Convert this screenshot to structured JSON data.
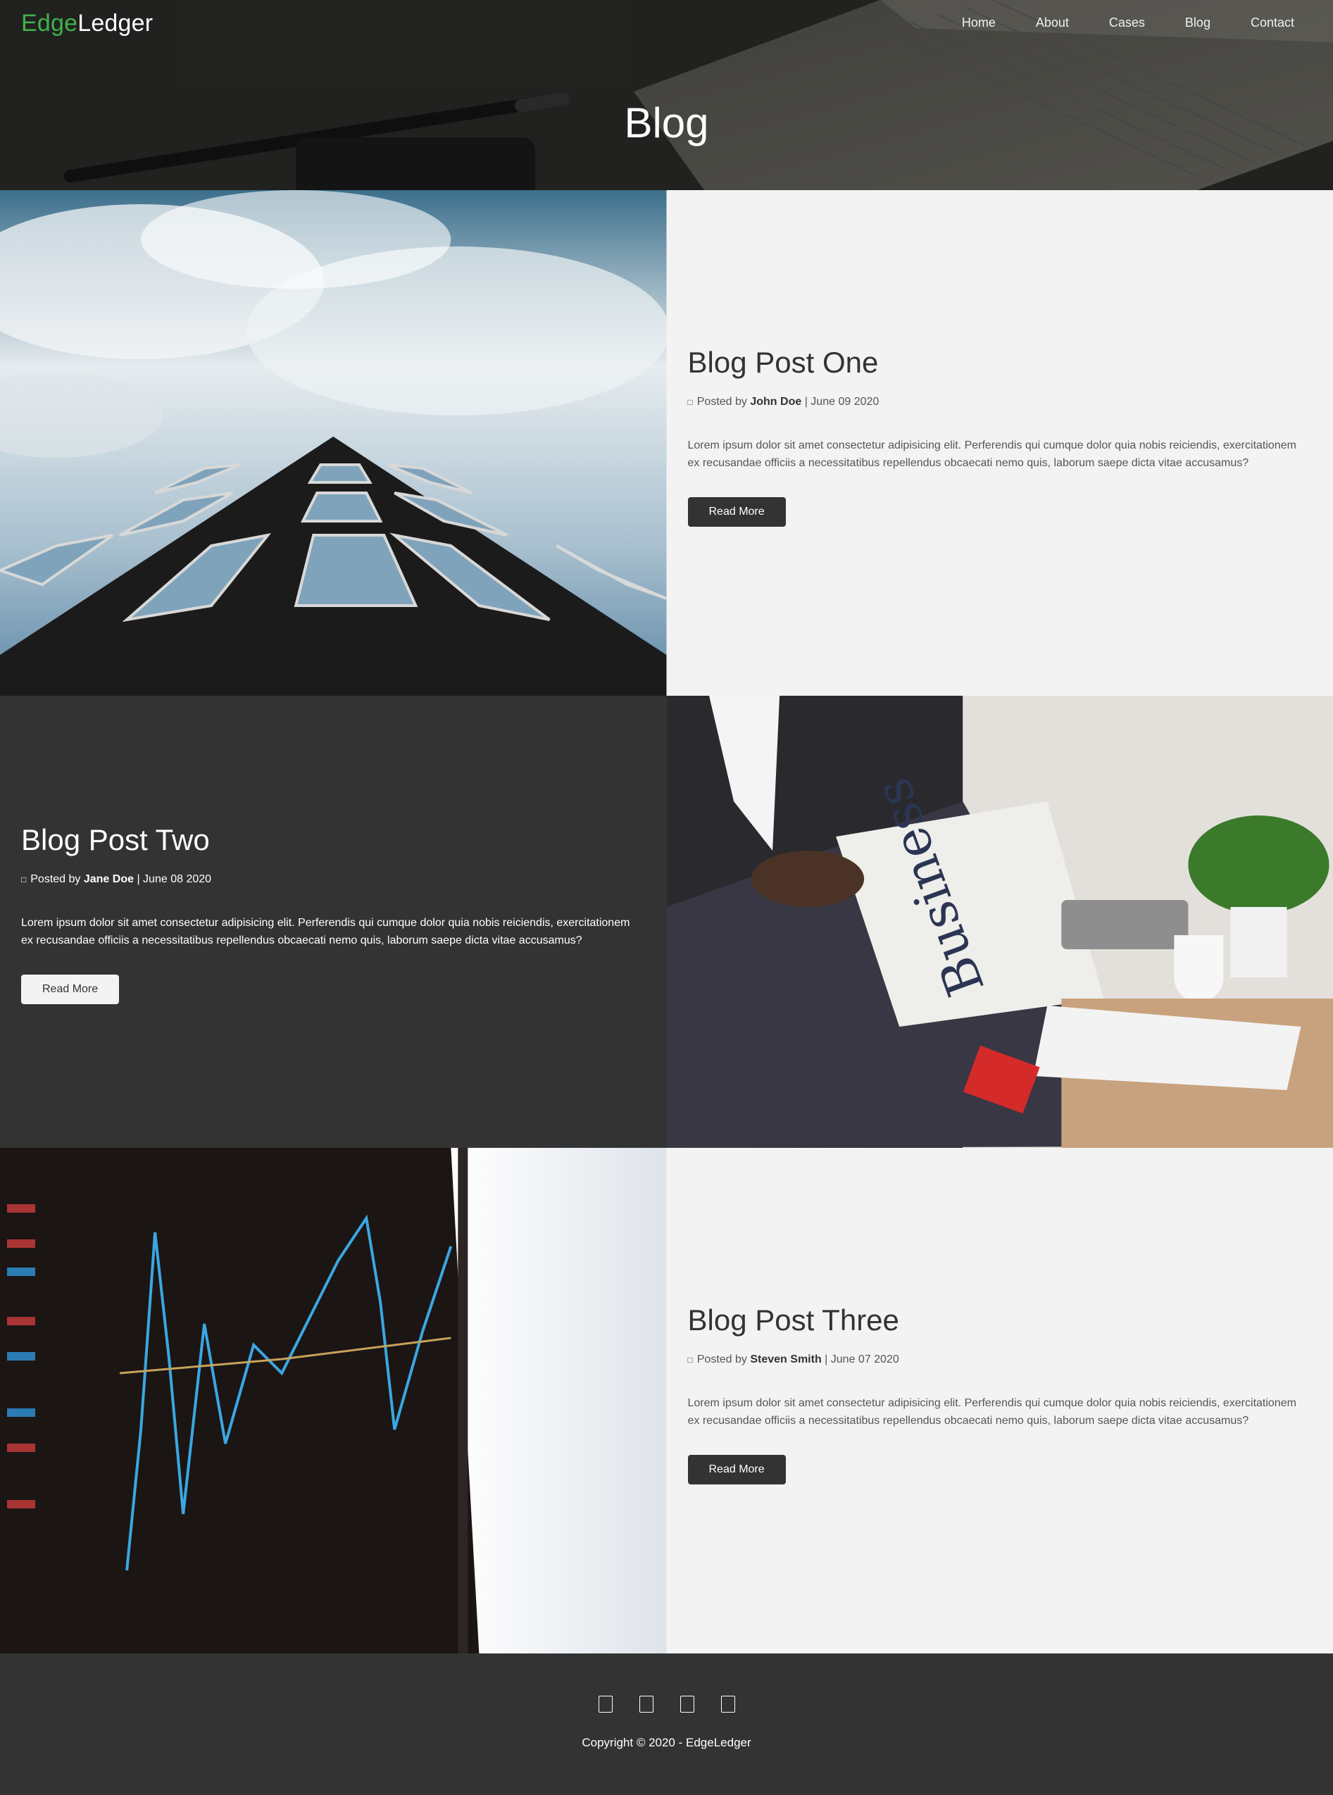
{
  "header": {
    "logo_part1": "Edge",
    "logo_part2": "Ledger",
    "nav": [
      "Home",
      "About",
      "Cases",
      "Blog",
      "Contact"
    ],
    "title": "Blog"
  },
  "posts": [
    {
      "title": "Blog Post One",
      "icon": "user-icon",
      "posted_by": "Posted by",
      "author": "John Doe",
      "date": "| June 09 2020",
      "excerpt": "Lorem ipsum dolor sit amet consectetur adipisicing elit. Perferendis qui cumque dolor quia nobis reiciendis, exercitationem ex recusandae officiis a necessitatibus repellendus obcaecati nemo quis, laborum saepe dicta vitae accusamus?",
      "button": "Read More",
      "image": "building-skyscraper-photo"
    },
    {
      "title": "Blog Post Two",
      "icon": "user-icon",
      "posted_by": "Posted by",
      "author": "Jane Doe",
      "date": "| June 08 2020",
      "excerpt": "Lorem ipsum dolor sit amet consectetur adipisicing elit. Perferendis qui cumque dolor quia nobis reiciendis, exercitationem ex recusandae officiis a necessitatibus repellendus obcaecati nemo quis, laborum saepe dicta vitae accusamus?",
      "button": "Read More",
      "image": "business-newspaper-photo"
    },
    {
      "title": "Blog Post Three",
      "icon": "user-icon",
      "posted_by": "Posted by",
      "author": "Steven Smith",
      "date": "| June 07 2020",
      "excerpt": "Lorem ipsum dolor sit amet consectetur adipisicing elit. Perferendis qui cumque dolor quia nobis reiciendis, exercitationem ex recusandae officiis a necessitatibus repellendus obcaecati nemo quis, laborum saepe dicta vitae accusamus?",
      "button": "Read More",
      "image": "stock-chart-screen-photo"
    }
  ],
  "footer": {
    "social_icons": [
      "twitter-icon",
      "facebook-icon",
      "instagram-icon",
      "linkedin-icon"
    ],
    "copyright": "Copyright © 2020 - EdgeLedger"
  },
  "colors": {
    "brand_green": "#3fb24a",
    "dark": "#333333",
    "light": "#f3f3f3"
  }
}
